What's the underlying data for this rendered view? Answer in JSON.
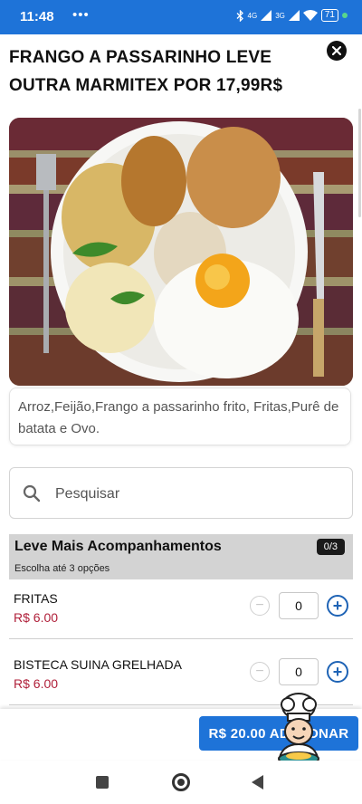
{
  "status_bar": {
    "time": "11:48",
    "dots": "•••",
    "network_1": "4G",
    "network_2": "3G",
    "battery": "71"
  },
  "product": {
    "title": "FRANGO A PASSARINHO LEVE OUTRA MARMITEX POR 17,99R$",
    "description": "Arroz,Feijão,Frango a passarinho frito, Fritas,Purê de batata e Ovo."
  },
  "search": {
    "placeholder": "Pesquisar"
  },
  "group": {
    "title": "Leve Mais Acompanhamentos",
    "subtitle": "Escolha até 3 opções",
    "counter": "0/3",
    "items": [
      {
        "name": "FRITAS",
        "price": "R$ 6.00",
        "qty": "0"
      },
      {
        "name": "BISTECA SUINA GRELHADA",
        "price": "R$ 6.00",
        "qty": "0"
      }
    ]
  },
  "add_button": {
    "label": "R$ 20.00 ADICIONAR"
  },
  "colors": {
    "primary": "#1e73d8",
    "price": "#b0203a"
  }
}
